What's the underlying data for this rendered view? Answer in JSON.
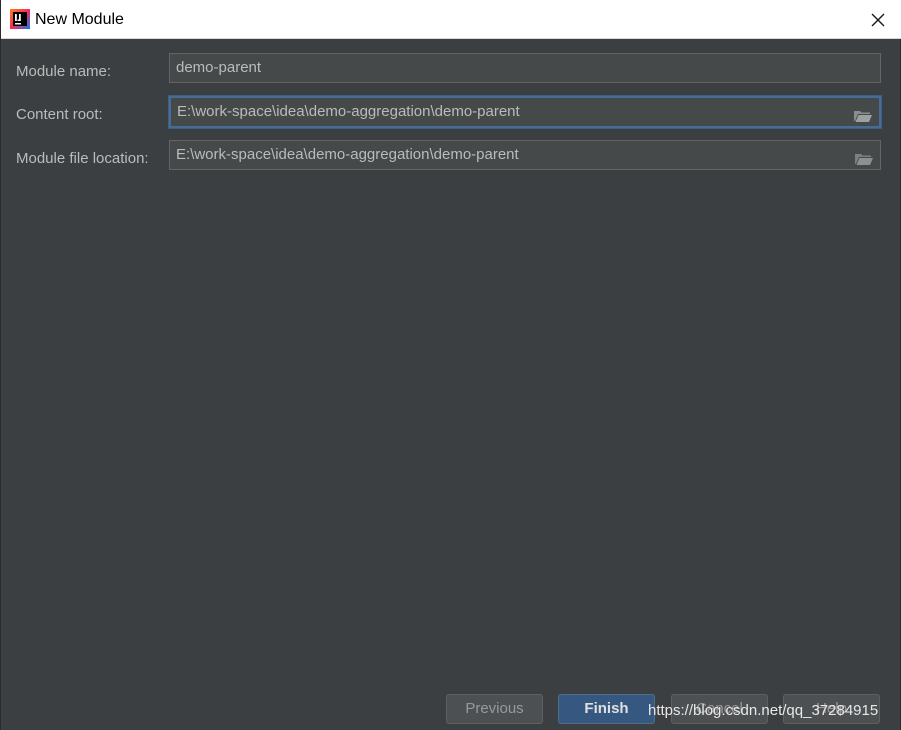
{
  "window": {
    "title": "New Module"
  },
  "form": {
    "module_name_label": "Module name:",
    "module_name_value": "demo-parent",
    "content_root_label": "Content root:",
    "content_root_value": "E:\\work-space\\idea\\demo-aggregation\\demo-parent",
    "module_file_location_label": "Module file location:",
    "module_file_location_value": "E:\\work-space\\idea\\demo-aggregation\\demo-parent"
  },
  "buttons": {
    "previous": "Previous",
    "finish": "Finish",
    "cancel": "Cancel",
    "help": "Help"
  },
  "watermark": "https://blog.csdn.net/qq_37284915",
  "icons": {
    "app": "intellij-idea-icon",
    "close": "close-icon",
    "folder": "folder-icon"
  },
  "colors": {
    "dialog_background": "#3c3f41",
    "field_background": "#45494a",
    "focus_border": "#466d94",
    "primary_button": "#365880"
  }
}
